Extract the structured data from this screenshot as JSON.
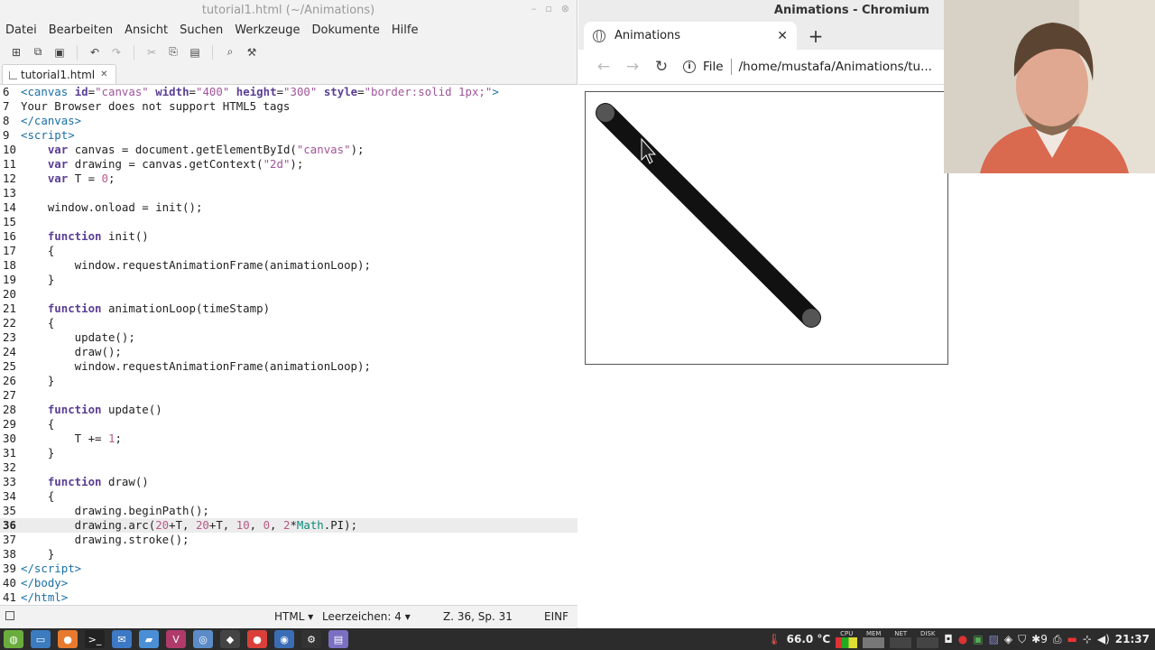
{
  "editor": {
    "title": "tutorial1.html (~/Animations)",
    "menu": [
      "Datei",
      "Bearbeiten",
      "Ansicht",
      "Suchen",
      "Werkzeuge",
      "Dokumente",
      "Hilfe"
    ],
    "tab_label": "tutorial1.html",
    "current_line": 36,
    "lines": [
      {
        "n": "6",
        "html": "<span class=\"tag\">&lt;canvas</span> <span class=\"attr\">id</span>=<span class=\"str\">\"canvas\"</span> <span class=\"attr\">width</span>=<span class=\"str\">\"400\"</span> <span class=\"attr\">height</span>=<span class=\"str\">\"300\"</span> <span class=\"attr\">style</span>=<span class=\"str\">\"border:solid 1px;\"</span><span class=\"tag\">&gt;</span>"
      },
      {
        "n": "7",
        "html": "Your Browser does not support HTML5 tags"
      },
      {
        "n": "8",
        "html": "<span class=\"tag\">&lt;/canvas&gt;</span>"
      },
      {
        "n": "9",
        "html": "<span class=\"tag\">&lt;script&gt;</span>"
      },
      {
        "n": "10",
        "html": "    <span class=\"kw\">var</span> canvas = document.getElementById(<span class=\"str\">\"canvas\"</span>);"
      },
      {
        "n": "11",
        "html": "    <span class=\"kw\">var</span> drawing = canvas.getContext(<span class=\"str\">\"2d\"</span>);"
      },
      {
        "n": "12",
        "html": "    <span class=\"kw\">var</span> T = <span class=\"num\">0</span>;"
      },
      {
        "n": "13",
        "html": ""
      },
      {
        "n": "14",
        "html": "    window.onload = init();"
      },
      {
        "n": "15",
        "html": ""
      },
      {
        "n": "16",
        "html": "    <span class=\"kw\">function</span> init()"
      },
      {
        "n": "17",
        "html": "    {"
      },
      {
        "n": "18",
        "html": "        window.requestAnimationFrame(animationLoop);"
      },
      {
        "n": "19",
        "html": "    }"
      },
      {
        "n": "20",
        "html": ""
      },
      {
        "n": "21",
        "html": "    <span class=\"kw\">function</span> animationLoop(timeStamp)"
      },
      {
        "n": "22",
        "html": "    {"
      },
      {
        "n": "23",
        "html": "        update();"
      },
      {
        "n": "24",
        "html": "        draw();"
      },
      {
        "n": "25",
        "html": "        window.requestAnimationFrame(animationLoop);"
      },
      {
        "n": "26",
        "html": "    }"
      },
      {
        "n": "27",
        "html": ""
      },
      {
        "n": "28",
        "html": "    <span class=\"kw\">function</span> update()"
      },
      {
        "n": "29",
        "html": "    {"
      },
      {
        "n": "30",
        "html": "        T += <span class=\"num\">1</span>;"
      },
      {
        "n": "31",
        "html": "    }"
      },
      {
        "n": "32",
        "html": ""
      },
      {
        "n": "33",
        "html": "    <span class=\"kw\">function</span> draw()"
      },
      {
        "n": "34",
        "html": "    {"
      },
      {
        "n": "35",
        "html": "        drawing.beginPath();"
      },
      {
        "n": "36",
        "html": "        drawing.arc(<span class=\"num\">20</span>+T, <span class=\"num\">20</span>+T, <span class=\"num\">10</span>, <span class=\"num\">0</span>, <span class=\"num\">2</span>*<span class=\"fn\">Math</span>.PI);"
      },
      {
        "n": "37",
        "html": "        drawing.stroke();"
      },
      {
        "n": "38",
        "html": "    }"
      },
      {
        "n": "39",
        "html": "<span class=\"tag\">&lt;/script&gt;</span>"
      },
      {
        "n": "40",
        "html": "<span class=\"tag\">&lt;/body&gt;</span>"
      },
      {
        "n": "41",
        "html": "<span class=\"tag\">&lt;/html&gt;</span>"
      }
    ],
    "status": {
      "language": "HTML ▾",
      "indent": "Leerzeichen: 4 ▾",
      "position": "Z. 36, Sp. 31",
      "mode": "EINF"
    }
  },
  "browser": {
    "window_title": "Animations - Chromium",
    "tab_title": "Animations",
    "url_scheme": "File",
    "url": "/home/mustafa/Animations/tu..."
  },
  "taskbar": {
    "temperature": "66.0 °C",
    "meters": [
      "CPU",
      "MEM",
      "NET",
      "DISK"
    ],
    "tray_count": "9",
    "clock": "21:37"
  },
  "colors": {
    "keyword": "#5a3e95",
    "tag": "#1a6fa6",
    "string": "#a0559a",
    "number": "#b55b8a",
    "taskbar_bg": "#2c2c2c"
  }
}
